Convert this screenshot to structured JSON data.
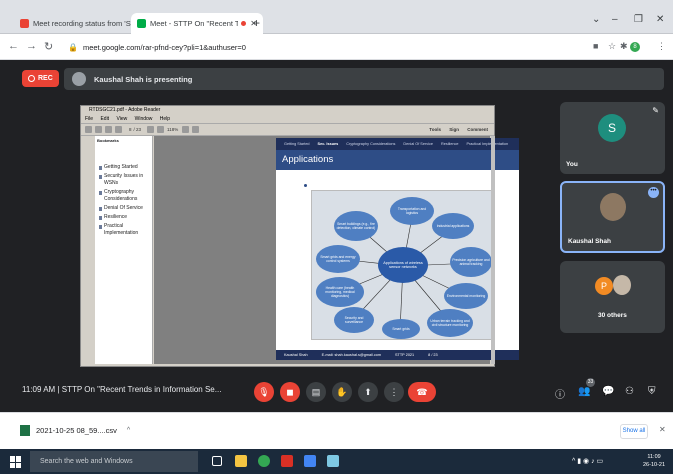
{
  "browser": {
    "tabs": [
      {
        "title": "Meet recording status from 'STT",
        "active": false
      },
      {
        "title": "Meet - STTP On \"Recent Tre",
        "active": true
      }
    ],
    "url": "meet.google.com/rar-pfnd-cey?pli=1&authuser=0",
    "profile_initial": "8"
  },
  "meet": {
    "rec_label": "REC",
    "presenting_text": "Kaushal Shah is presenting",
    "time": "11:09 AM",
    "meeting_title": "STTP On \"Recent Trends in Information Se...",
    "participants": {
      "you": {
        "initial": "S",
        "name": "You"
      },
      "presenter": {
        "name": "Kaushal Shah"
      },
      "others": {
        "initial": "P",
        "name": "30 others"
      },
      "count_badge": "33"
    },
    "colors": {
      "stage": "#202124",
      "end_call": "#ea4335",
      "accent": "#8ab4f8"
    }
  },
  "reader": {
    "window_title": "RTDSGC21.pdf - Adobe Reader",
    "menu": [
      "File",
      "Edit",
      "View",
      "Window",
      "Help"
    ],
    "zoom": "118%",
    "page_field": "8",
    "page_total": "/ 23",
    "toolbar_right": [
      "Tools",
      "Sign",
      "Comment"
    ],
    "bookmarks_label": "Bookmarks",
    "bookmarks": [
      "Getting Started",
      "Security Issues in WSNs",
      "Cryptography Considerations",
      "Denial Of Service",
      "Resilience",
      "Practical Implementation"
    ]
  },
  "slide": {
    "nav": [
      "Getting Started",
      "Sec. Issues",
      "Cryptography Considerations",
      "Denial Of Service",
      "Resilience",
      "Practical Implementation"
    ],
    "active_nav": 1,
    "title": "Applications",
    "center": "Applications of wireless sensor networks",
    "nodes": [
      "Transportation and logistics",
      "Industrial applications",
      "Precision agriculture and animal tracking",
      "Environmental monitoring",
      "Urban terrain tracking and civil structure monitoring",
      "Smart grids",
      "Security and surveillance",
      "Health care (health monitoring, medical diagnostics)",
      "Smart grids and energy control systems",
      "Smart buildings (e.g., fire detection, climate control)"
    ],
    "footer": {
      "author": "Kaushal Shah",
      "email": "E-mail: shah.kaushal.s@gmail.com",
      "event": "STTP 2021",
      "page": "8 / 23"
    }
  },
  "download": {
    "file": "2021-10-25 08_59....csv",
    "show_all": "Show all"
  },
  "taskbar": {
    "search_placeholder": "Search the web and Windows",
    "time": "11:09",
    "date": "26-10-21"
  }
}
